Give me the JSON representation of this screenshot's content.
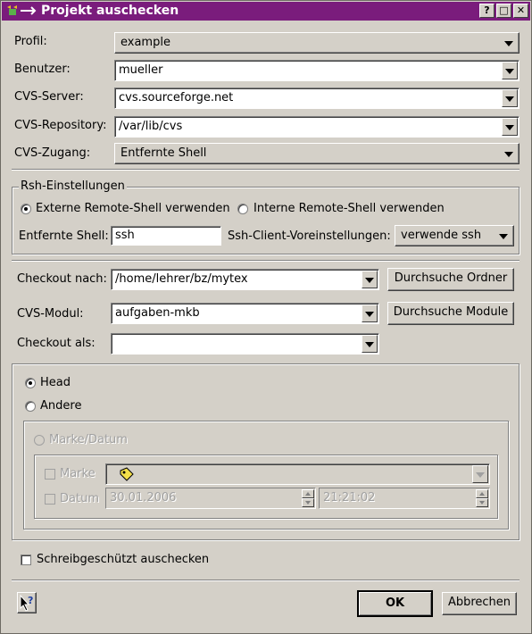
{
  "window": {
    "title": "Projekt auschecken",
    "buttons": {
      "help": "?",
      "maximize": "□",
      "close": "✕"
    }
  },
  "form": {
    "profil_label": "Profil:",
    "profil_value": "example",
    "benutzer_label": "Benutzer:",
    "benutzer_value": "mueller",
    "cvs_server_label": "CVS-Server:",
    "cvs_server_value": "cvs.sourceforge.net",
    "cvs_repository_label": "CVS-Repository:",
    "cvs_repository_value": "/var/lib/cvs",
    "cvs_zugang_label": "CVS-Zugang:",
    "cvs_zugang_value": "Entfernte Shell"
  },
  "rsh": {
    "group_title": "Rsh-Einstellungen",
    "externe_label": "Externe Remote-Shell verwenden",
    "interne_label": "Interne Remote-Shell verwenden",
    "entfernte_shell_label": "Entfernte Shell:",
    "entfernte_shell_value": "ssh",
    "client_label": "Ssh-Client-Voreinstellungen:",
    "client_value": "verwende ssh"
  },
  "checkout": {
    "nach_label": "Checkout nach:",
    "nach_value": "/home/lehrer/bz/mytex",
    "browse_folder": "Durchsuche Ordner",
    "modul_label": "CVS-Modul:",
    "modul_value": "aufgaben-mkb",
    "browse_modules": "Durchsuche Module",
    "als_label": "Checkout als:",
    "als_value": ""
  },
  "revision": {
    "head_label": "Head",
    "andere_label": "Andere",
    "marke_datum_label": "Marke/Datum",
    "marke_label": "Marke",
    "datum_label": "Datum",
    "date_value": "30.01.2006",
    "time_value": "21:21:02"
  },
  "readonly_label": "Schreibgeschützt auschecken",
  "footer": {
    "ok": "OK",
    "cancel": "Abbrechen"
  }
}
